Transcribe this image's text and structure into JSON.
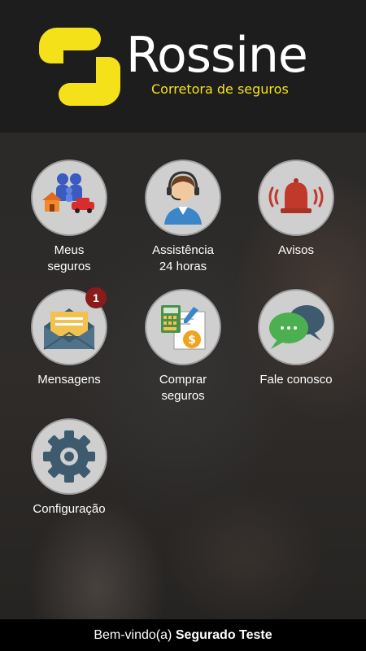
{
  "header": {
    "brand": "Rossine",
    "tagline": "Corretora de seguros"
  },
  "menu": {
    "items": [
      {
        "label_line1": "Meus",
        "label_line2": "seguros",
        "icon": "family-house-car-icon"
      },
      {
        "label_line1": "Assistência",
        "label_line2": "24 horas",
        "icon": "headset-operator-icon"
      },
      {
        "label_line1": "Avisos",
        "label_line2": "",
        "icon": "alarm-bell-icon"
      },
      {
        "label_line1": "Mensagens",
        "label_line2": "",
        "icon": "open-envelope-icon",
        "badge": "1"
      },
      {
        "label_line1": "Comprar",
        "label_line2": "seguros",
        "icon": "calculator-document-icon"
      },
      {
        "label_line1": "Fale conosco",
        "label_line2": "",
        "icon": "chat-bubbles-icon"
      },
      {
        "label_line1": "Configuração",
        "label_line2": "",
        "icon": "gear-icon"
      }
    ]
  },
  "footer": {
    "greeting": "Bem-vindo(a)",
    "user_name": "Segurado Teste"
  },
  "colors": {
    "brand_yellow": "#f5e11a",
    "badge_red": "#8b1a1a",
    "header_bg": "#1d1d1d",
    "footer_bg": "#000000"
  }
}
